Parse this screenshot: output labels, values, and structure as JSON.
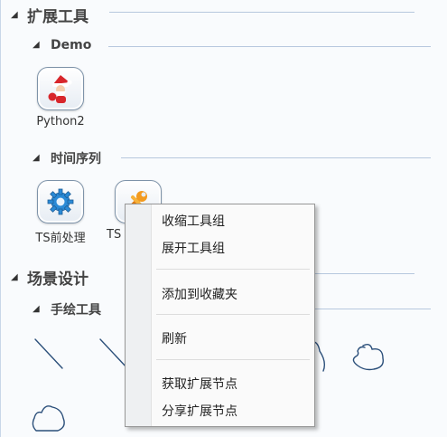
{
  "sections": [
    {
      "title": "扩展工具"
    },
    {
      "title": "场景设计"
    }
  ],
  "groups": [
    {
      "title": "Demo"
    },
    {
      "title": "时间序列"
    },
    {
      "title": "手绘工具"
    }
  ],
  "tools": {
    "python2": {
      "label": "Python2",
      "icon": "santa-icon"
    },
    "ts_preprocess": {
      "label": "TS前处理",
      "icon": "gear-icon"
    },
    "ts_second": {
      "label": "TS",
      "icon": "wrench-icon"
    }
  },
  "context_menu": {
    "items": [
      {
        "label": "收缩工具组"
      },
      {
        "label": "展开工具组"
      },
      {
        "label": "添加到收藏夹"
      },
      {
        "label": "刷新"
      },
      {
        "label": "获取扩展节点"
      },
      {
        "label": "分享扩展节点"
      }
    ]
  },
  "colors": {
    "accent_blue": "#1f77d0",
    "rule": "#b7c8de",
    "sketch_stroke": "#2b4f7a"
  }
}
